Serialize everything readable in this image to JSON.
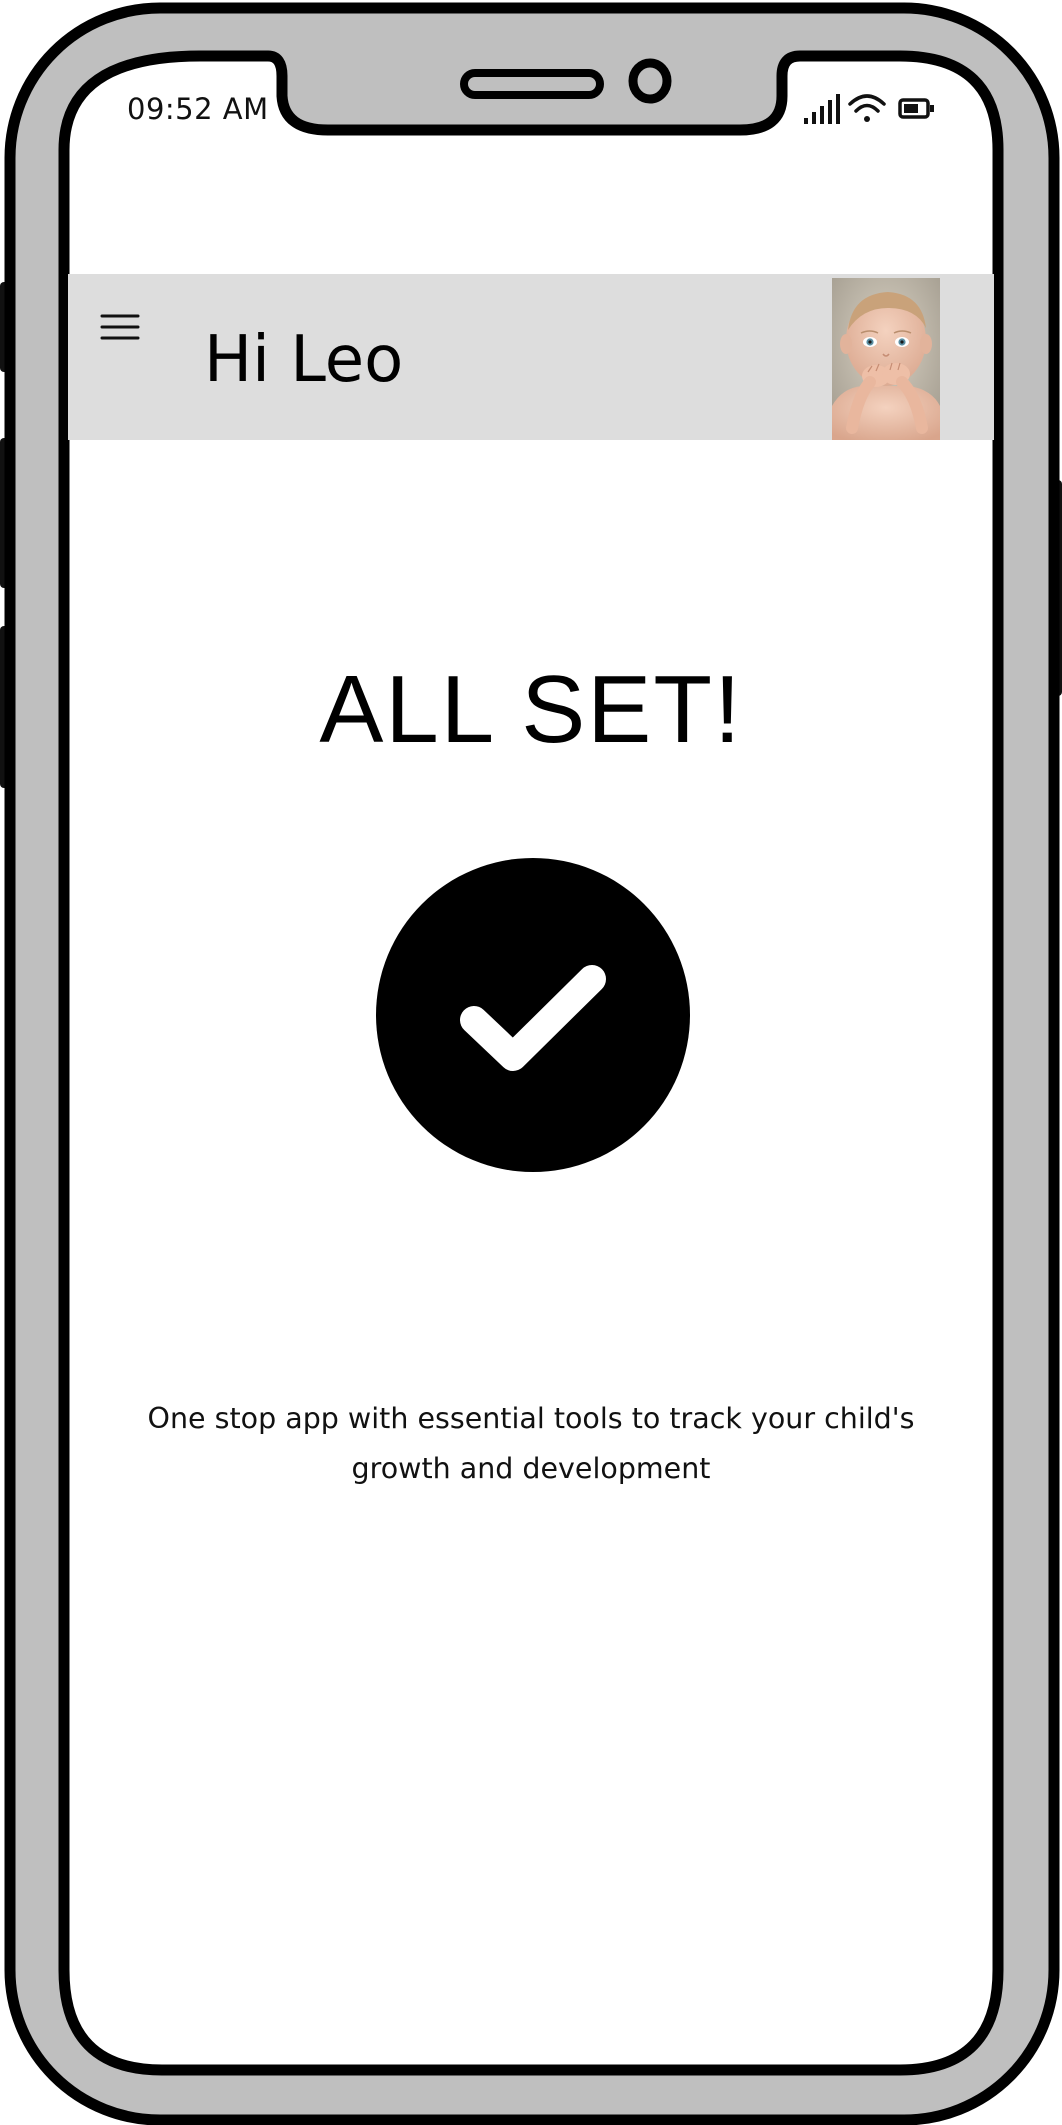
{
  "status_bar": {
    "time": "09:52 AM",
    "icons": [
      "signal-icon",
      "wifi-icon",
      "battery-icon"
    ]
  },
  "header": {
    "menu_icon": "hamburger-menu-icon",
    "greeting": "Hi Leo",
    "avatar_icon": "baby-avatar-photo"
  },
  "main": {
    "headline": "ALL SET!",
    "status_icon": "check-circle-icon",
    "description": "One stop app with essential tools to track your child's growth and development"
  },
  "colors": {
    "frame": "#bfbfbf",
    "outline": "#000000",
    "header_bg": "#dddddd",
    "screen_bg": "#ffffff"
  }
}
